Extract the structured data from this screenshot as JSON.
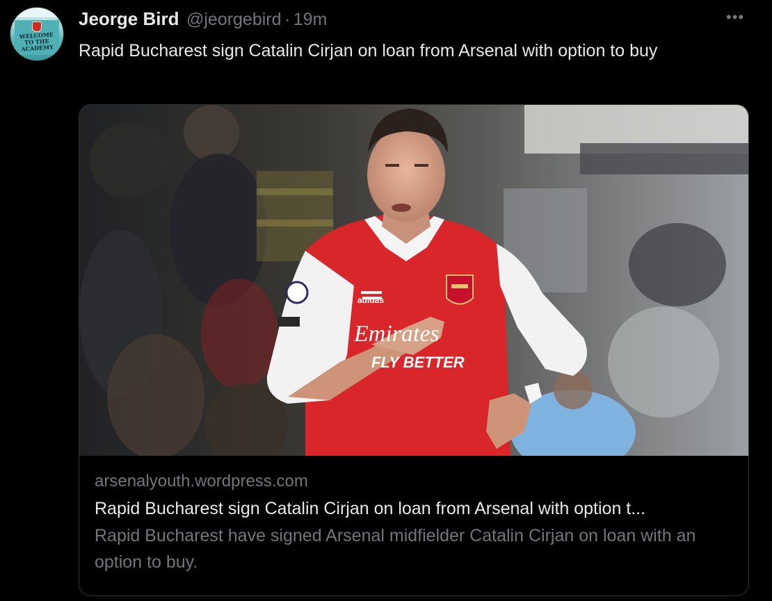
{
  "tweet": {
    "author": {
      "display_name": "Jeorge Bird",
      "handle": "@jeorgebird",
      "avatar_text": "WELCOME TO THE ACADEMY"
    },
    "separator": "·",
    "timestamp": "19m",
    "more_label": "•••",
    "text": "Rapid Bucharest sign Catalin Cirjan on loan from Arsenal with option to buy"
  },
  "card": {
    "image_icon": "photo-of-arsenal-player",
    "jersey_sponsor": "Emirates FLY BETTER",
    "jersey_brand": "adidas",
    "domain": "arsenalyouth.wordpress.com",
    "title": "Rapid Bucharest sign Catalin Cirjan on loan from Arsenal with option t...",
    "description": "Rapid Bucharest have signed Arsenal midfielder Catalin Cirjan on loan with an option to buy."
  },
  "colors": {
    "background": "#000000",
    "primary_text": "#e7e9ea",
    "secondary_text": "#71767b",
    "border": "#2f3336",
    "arsenal_red": "#d8262b"
  }
}
